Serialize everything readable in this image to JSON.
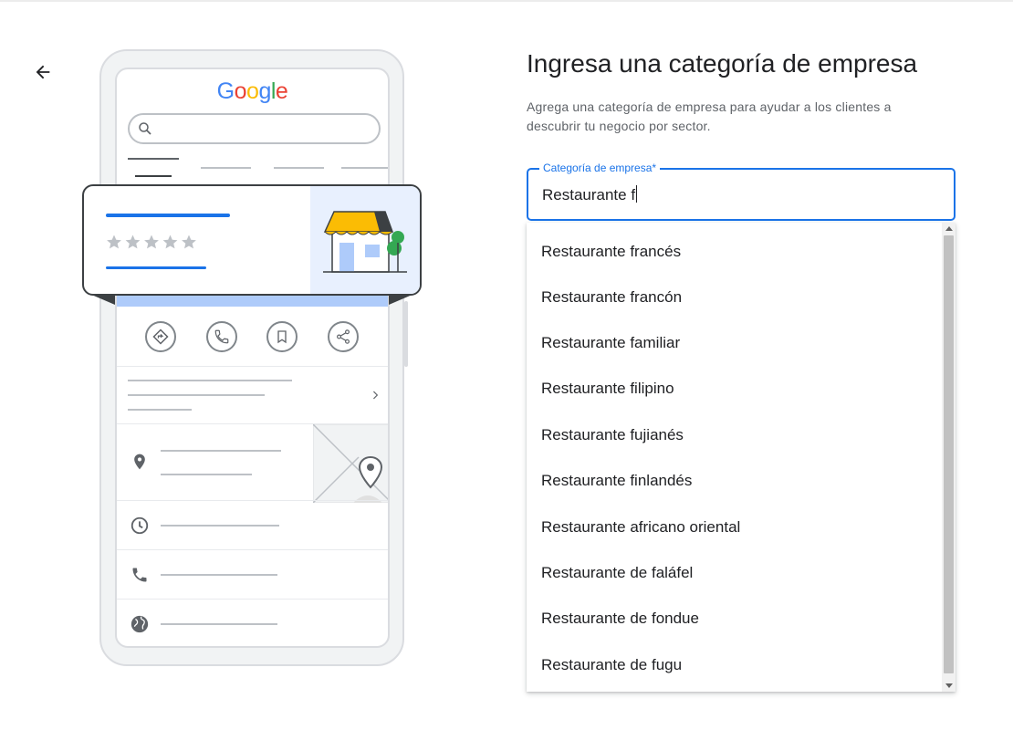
{
  "header": {
    "title": "Ingresa una categoría de empresa",
    "description": "Agrega una categoría de empresa para ayudar a los clientes a descubrir tu negocio por sector."
  },
  "illustration": {
    "logo_letters": [
      "G",
      "o",
      "o",
      "g",
      "l",
      "e"
    ],
    "logo_colors": [
      "#4285f4",
      "#ea4335",
      "#fbbc05",
      "#4285f4",
      "#34a853",
      "#ea4335"
    ],
    "rating_stars": 5
  },
  "category_field": {
    "label": "Categoría de empresa*",
    "value": "Restaurante f"
  },
  "suggestions": [
    "Restaurante francés",
    "Restaurante francón",
    "Restaurante familiar",
    "Restaurante filipino",
    "Restaurante fujianés",
    "Restaurante finlandés",
    "Restaurante africano oriental",
    "Restaurante de faláfel",
    "Restaurante de fondue",
    "Restaurante de fugu"
  ],
  "colors": {
    "accent": "#1a73e8",
    "text_primary": "#202124",
    "text_secondary": "#5f6368",
    "awning_yellow": "#fbbc04",
    "tree_green": "#34a853"
  }
}
